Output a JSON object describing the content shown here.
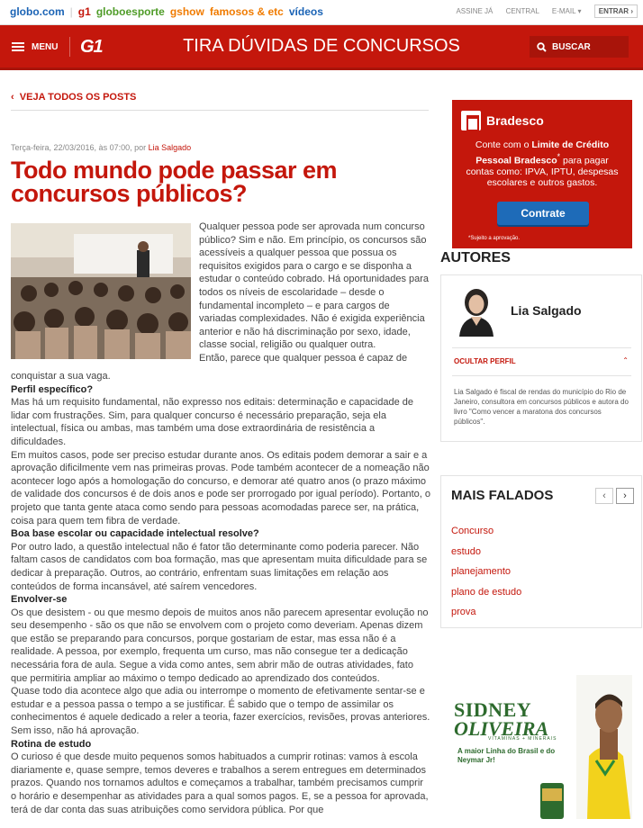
{
  "topbar": {
    "links": [
      "globo.com",
      "g1",
      "globoesporte",
      "gshow",
      "famosos & etc",
      "vídeos"
    ],
    "link_colors": [
      "#1a63b5",
      "#c4170c",
      "#4f9c28",
      "#f07b00",
      "#f07b00",
      "#1a63b5"
    ],
    "right": [
      "ASSINE JÁ",
      "CENTRAL",
      "E-MAIL",
      "ENTRAR"
    ]
  },
  "header": {
    "menu_label": "MENU",
    "logo": "G1",
    "title": "TIRA DÚVIDAS DE CONCURSOS",
    "search_label": "BUSCAR",
    "color": "#c4170c"
  },
  "post": {
    "back_link": "VEJA TODOS OS POSTS",
    "meta_prefix": "Terça-feira, 22/03/2016, às 07:00, por ",
    "meta_author": "Lia Salgado",
    "title": "Todo mundo pode passar em concursos públicos?",
    "intro": "Qualquer pessoa pode ser aprovada num concurso público? Sim e não. Em princípio, os concursos são acessíveis a qualquer pessoa que possua os requisitos exigidos para o cargo e se disponha a estudar o conteúdo cobrado. Há oportunidades para todos os níveis de escolaridade – desde o fundamental incompleto – e para cargos de variadas complexidades. Não é exigida experiência anterior e não há discriminação por sexo, idade, classe social, religião ou qualquer outra.",
    "intro_last": "Então, parece que qualquer pessoa é capaz de",
    "blocks": [
      {
        "type": "p",
        "text": "conquistar a sua vaga."
      },
      {
        "type": "h",
        "text": "Perfil específico?"
      },
      {
        "type": "p",
        "text": "Mas há um requisito fundamental, não expresso nos editais: determinação e capacidade de lidar com frustrações. Sim, para qualquer concurso é necessário preparação, seja ela intelectual, física ou ambas, mas também uma dose extraordinária de resistência a dificuldades."
      },
      {
        "type": "p",
        "text": "Em muitos casos, pode ser preciso estudar durante anos. Os editais podem demorar a sair e a aprovação dificilmente vem nas primeiras provas. Pode também acontecer de a nomeação não acontecer logo após a homologação do concurso, e demorar até quatro anos (o prazo máximo de validade dos concursos é de dois anos e pode ser prorrogado por igual período). Portanto, o projeto que tanta gente ataca como sendo para pessoas acomodadas parece ser, na prática, coisa para quem tem fibra de verdade."
      },
      {
        "type": "h",
        "text": "Boa base escolar ou capacidade intelectual resolve?"
      },
      {
        "type": "p",
        "text": "Por outro lado, a questão intelectual não é fator tão determinante como poderia parecer. Não faltam casos de candidatos com boa formação, mas que apresentam muita dificuldade para se dedicar à preparação. Outros, ao contrário, enfrentam suas limitações em relação aos conteúdos de forma incansável, até saírem vencedores."
      },
      {
        "type": "h",
        "text": "Envolver-se"
      },
      {
        "type": "p",
        "text": "Os que desistem - ou que mesmo depois de muitos anos não parecem apresentar evolução no seu desempenho - são os que não se envolvem com o projeto como deveriam. Apenas dizem que estão se preparando para concursos, porque gostariam de estar, mas essa não é a realidade. A pessoa, por exemplo, frequenta um curso, mas não consegue ter a dedicação necessária fora de aula. Segue a vida como antes, sem abrir mão de outras atividades, fato que permitiria ampliar ao máximo o tempo dedicado ao aprendizado dos conteúdos."
      },
      {
        "type": "p",
        "text": "Quase todo dia acontece algo que adia ou interrompe o momento de efetivamente sentar-se e estudar e a pessoa passa o tempo a se justificar. É sabido que o tempo de assimilar os conhecimentos é aquele dedicado a reler a teoria, fazer exercícios, revisões, provas anteriores. Sem isso, não há aprovação."
      },
      {
        "type": "h",
        "text": "Rotina de estudo"
      },
      {
        "type": "p",
        "text": "O curioso é que desde muito pequenos somos habituados a cumprir rotinas: vamos à escola diariamente e, quase sempre, temos deveres e trabalhos a serem entregues em determinados prazos. Quando nos tornamos adultos e começamos a trabalhar, também precisamos cumprir o horário e desempenhar as atividades para a qual somos pagos. E, se a pessoa for aprovada, terá de dar conta das suas atribuições como servidora pública. Por que"
      }
    ]
  },
  "ad_bradesco": {
    "brand": "Bradesco",
    "line1": "Conte com o ",
    "line1_bold": "Limite de Crédito Pessoal Bradesco",
    "line1_sup": "*",
    "line2": " para pagar contas como: IPVA, IPTU, despesas escolares e outros gastos.",
    "button": "Contrate",
    "footnote": "*Sujeito a aprovação."
  },
  "authors": {
    "heading": "AUTORES",
    "name": "Lia Salgado",
    "toggle": "OCULTAR PERFIL",
    "bio": "Lia Salgado é fiscal de rendas do município do Rio de Janeiro, consultora em concursos públicos e autora do livro \"Como vencer a maratona dos concursos públicos\"."
  },
  "most_talked": {
    "heading": "MAIS FALADOS",
    "items": [
      "Concurso",
      "estudo",
      "planejamento",
      "plano de estudo",
      "prova"
    ]
  },
  "ad_sidney": {
    "brand_line1": "SIDNEY",
    "brand_line2": "OLIVEIRA",
    "brand_line3": "VITAMINAS + MINERAIS",
    "tagline": "A maior Linha do Brasil e do Neymar Jr!"
  }
}
